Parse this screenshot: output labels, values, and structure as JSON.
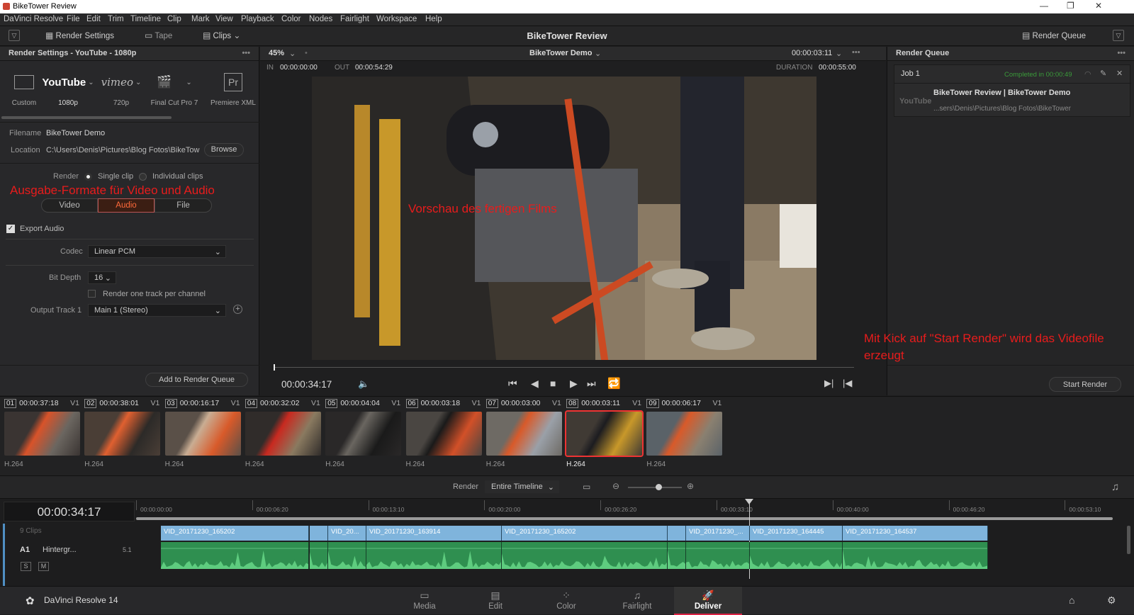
{
  "window": {
    "title": "BikeTower Review",
    "controls": [
      "—",
      "❐",
      "✕"
    ]
  },
  "menu": [
    "DaVinci Resolve",
    "File",
    "Edit",
    "Trim",
    "Timeline",
    "Clip",
    "Mark",
    "View",
    "Playback",
    "Color",
    "Nodes",
    "Fairlight",
    "Workspace",
    "Help"
  ],
  "toolbar": {
    "render_settings": "Render Settings",
    "tape": "Tape",
    "clips": "Clips",
    "project_title": "BikeTower Review",
    "render_queue": "Render Queue"
  },
  "render_settings": {
    "header": "Render Settings - YouTube - 1080p",
    "presets": [
      {
        "label": "Custom",
        "logo": ""
      },
      {
        "label": "1080p",
        "logo": "YouTube"
      },
      {
        "label": "720p",
        "logo": "vimeo"
      },
      {
        "label": "Final Cut Pro 7",
        "logo": ""
      },
      {
        "label": "Premiere XML",
        "logo": "Pr"
      }
    ],
    "filename_label": "Filename",
    "filename": "BikeTower Demo",
    "location_label": "Location",
    "location": "C:\\Users\\Denis\\Pictures\\Blog Fotos\\BikeTow",
    "browse": "Browse",
    "render_label": "Render",
    "single_clip": "Single clip",
    "individual_clips": "Individual clips",
    "tabs": [
      "Video",
      "Audio",
      "File"
    ],
    "active_tab": "Audio",
    "export_audio": "Export Audio",
    "codec_label": "Codec",
    "codec": "Linear PCM",
    "bit_depth_label": "Bit Depth",
    "bit_depth": "16",
    "one_track": "Render one track per channel",
    "output_track_label": "Output Track 1",
    "output_track": "Main 1 (Stereo)",
    "add_queue": "Add to Render Queue"
  },
  "viewer": {
    "zoom": "45%",
    "clip_name": "BikeTower Demo",
    "tc_right": "00:00:03:11",
    "in_label": "IN",
    "in": "00:00:00:00",
    "out_label": "OUT",
    "out": "00:00:54:29",
    "duration_label": "DURATION",
    "duration": "00:00:55:00",
    "timecode": "00:00:34:17"
  },
  "queue": {
    "header": "Render Queue",
    "job": "Job 1",
    "status": "Completed in 00:00:49",
    "job_title": "BikeTower Review | BikeTower Demo",
    "job_path": "...sers\\Denis\\Pictures\\Blog Fotos\\BikeTower",
    "job_logo": "YouTube",
    "start_render": "Start Render"
  },
  "annotations": {
    "formats": "Ausgabe-Formate für Video und Audio",
    "preview": "Vorschau des fertigen Films",
    "start": "Mit Kick auf \"Start Render\" wird das Videofile erzeugt"
  },
  "clips": [
    {
      "num": "01",
      "tc": "00:00:37:18",
      "track": "V1",
      "codec": "H.264"
    },
    {
      "num": "02",
      "tc": "00:00:38:01",
      "track": "V1",
      "codec": "H.264"
    },
    {
      "num": "03",
      "tc": "00:00:16:17",
      "track": "V1",
      "codec": "H.264"
    },
    {
      "num": "04",
      "tc": "00:00:32:02",
      "track": "V1",
      "codec": "H.264"
    },
    {
      "num": "05",
      "tc": "00:00:04:04",
      "track": "V1",
      "codec": "H.264"
    },
    {
      "num": "06",
      "tc": "00:00:03:18",
      "track": "V1",
      "codec": "H.264"
    },
    {
      "num": "07",
      "tc": "00:00:03:00",
      "track": "V1",
      "codec": "H.264"
    },
    {
      "num": "08",
      "tc": "00:00:03:11",
      "track": "V1",
      "codec": "H.264"
    },
    {
      "num": "09",
      "tc": "00:00:06:17",
      "track": "V1",
      "codec": "H.264"
    }
  ],
  "render_bar": {
    "label": "Render",
    "value": "Entire Timeline"
  },
  "timeline": {
    "timecode": "00:00:34:17",
    "ticks": [
      "00:00:00:00",
      "00:00:06:20",
      "00:00:13:10",
      "00:00:20:00",
      "00:00:26:20",
      "00:00:33:10",
      "00:00:40:00",
      "00:00:46:20",
      "00:00:53:10"
    ],
    "video_track": "9 Clips",
    "audio_track_id": "A1",
    "audio_track_name": "Hintergr...",
    "audio_channels": "5.1",
    "solo": "S",
    "mute": "M",
    "video_clips": [
      "VID_20171230_165202",
      "",
      "VID_20...",
      "VID_20171230_163914",
      "VID_20171230_165202",
      "",
      "VID_20171230_...",
      "VID_20171230_164445",
      "VID_20171230_164537"
    ]
  },
  "pages": {
    "app_name": "DaVinci Resolve 14",
    "items": [
      "Media",
      "Edit",
      "Color",
      "Fairlight",
      "Deliver"
    ],
    "active": "Deliver"
  }
}
